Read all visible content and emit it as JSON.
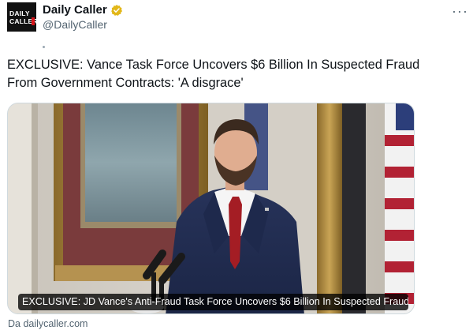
{
  "account": {
    "avatar_logo_line1": "DAILY",
    "avatar_logo_line2": "CALLER",
    "display_name": "Daily Caller",
    "handle": "@DailyCaller",
    "verified_badge_color": "#e2b719"
  },
  "post": {
    "text": "EXCLUSIVE: Vance Task Force Uncovers $6 Billion In Suspected Fraud From Government Contracts: 'A disgrace'"
  },
  "link_card": {
    "title": "EXCLUSIVE: JD Vance's Anti-Fraud Task Force Uncovers $6 Billion In Suspected Fraud...",
    "source_label": "Da dailycaller.com",
    "image_icon": "photo-of-speaker-at-podium"
  },
  "colors": {
    "text": "#0f1419",
    "secondary": "#536471",
    "border": "#cfd9de"
  }
}
